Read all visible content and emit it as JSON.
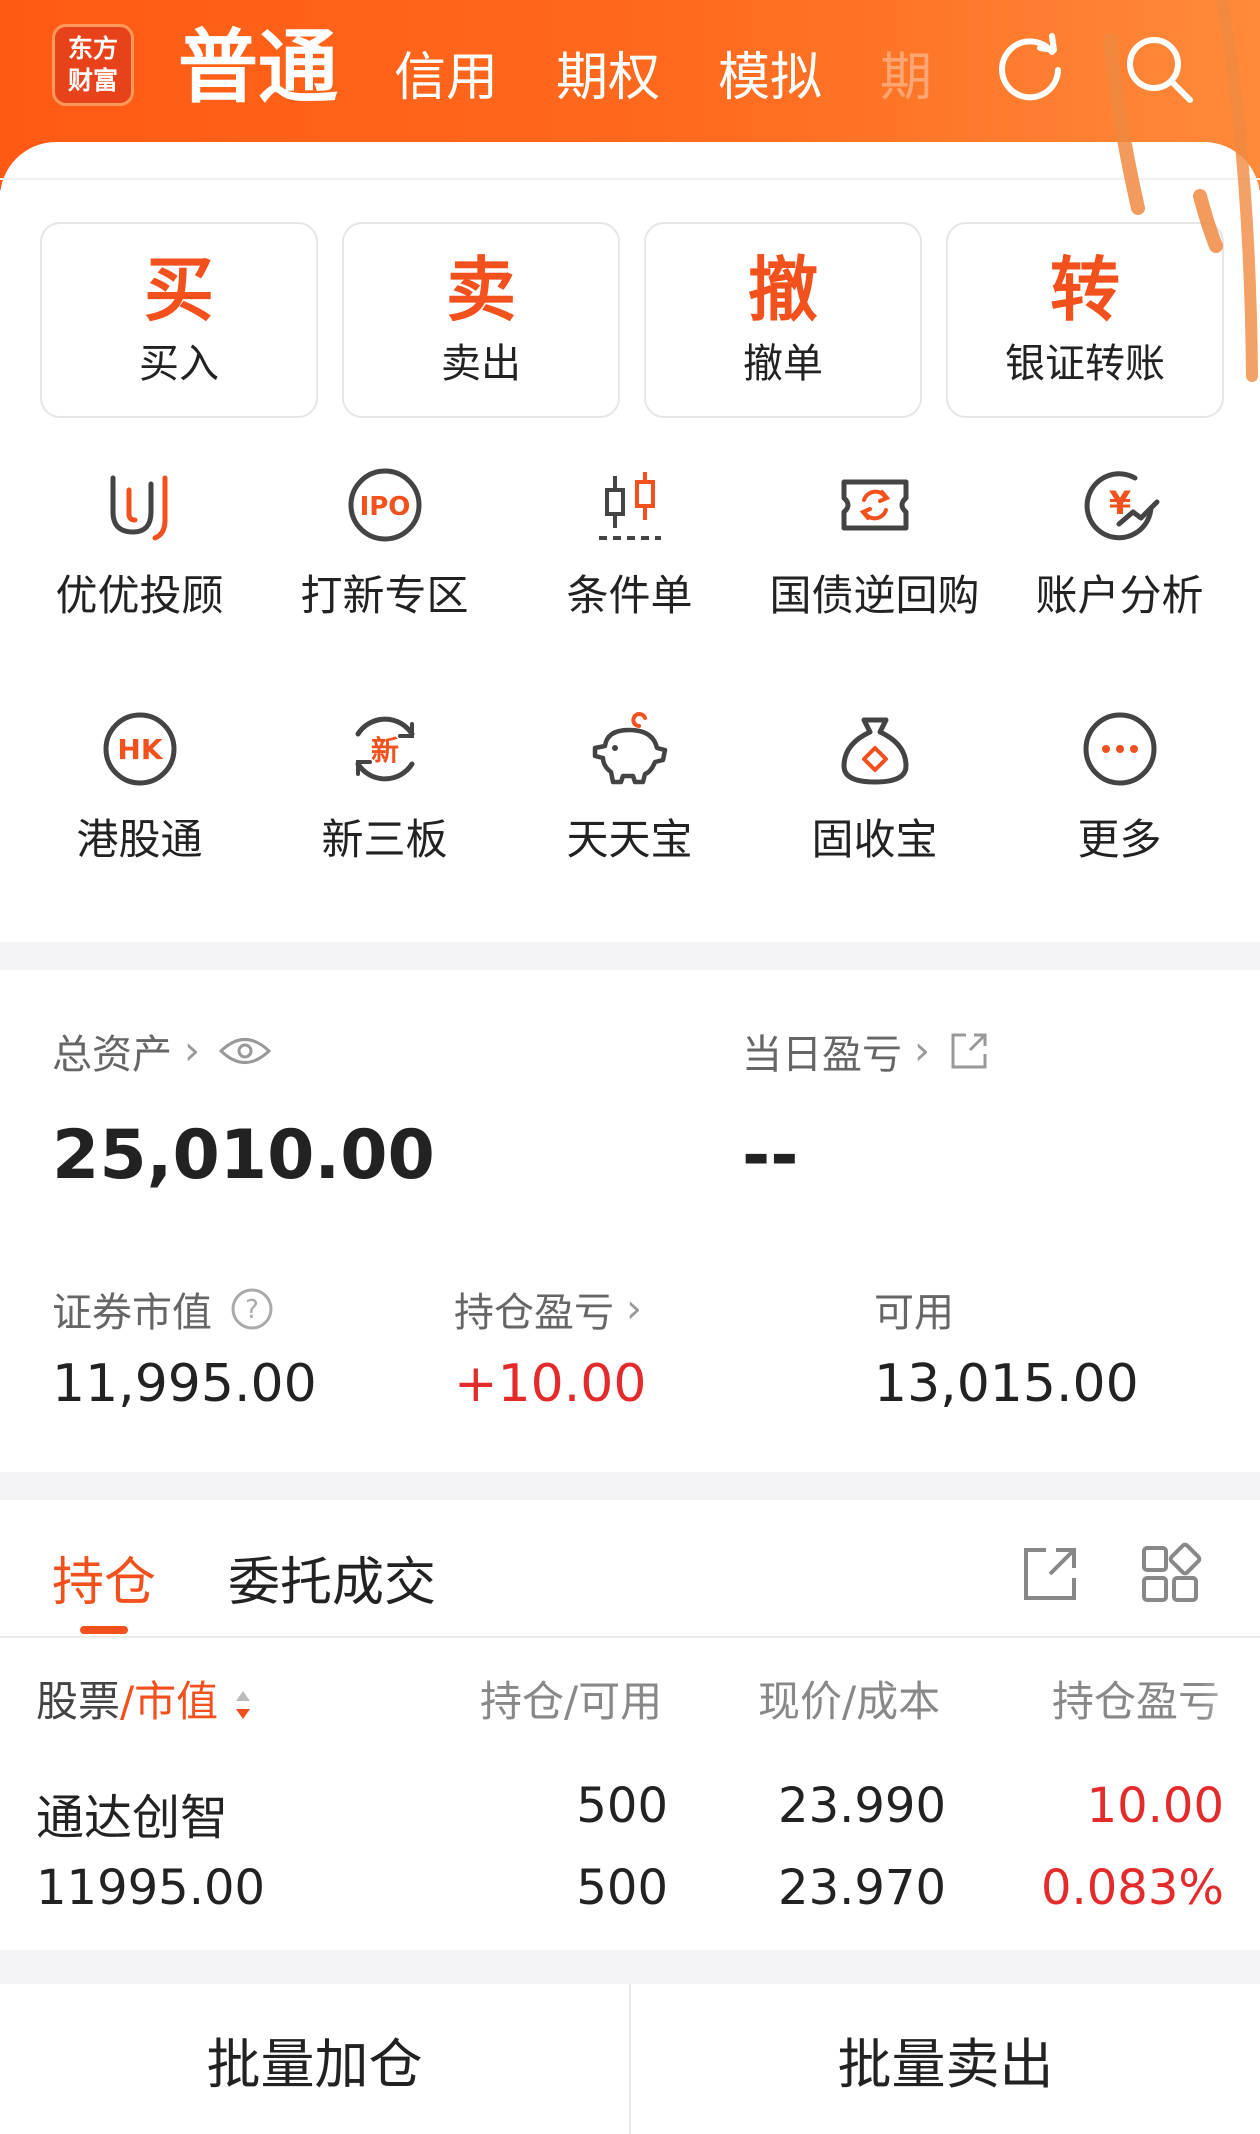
{
  "header": {
    "logo_line1": "东方",
    "logo_line2": "财富",
    "tabs": [
      {
        "label": "普通"
      },
      {
        "label": "信用"
      },
      {
        "label": "期权"
      },
      {
        "label": "模拟"
      },
      {
        "label": "期"
      }
    ]
  },
  "quick_actions": [
    {
      "char": "买",
      "label": "买入"
    },
    {
      "char": "卖",
      "label": "卖出"
    },
    {
      "char": "撤",
      "label": "撤单"
    },
    {
      "char": "转",
      "label": "银证转账"
    }
  ],
  "services_row1": [
    {
      "label": "优优投顾",
      "icon": "uu-advisor-icon"
    },
    {
      "label": "打新专区",
      "icon": "ipo-icon"
    },
    {
      "label": "条件单",
      "icon": "candlestick-icon"
    },
    {
      "label": "国债逆回购",
      "icon": "repo-icon"
    },
    {
      "label": "账户分析",
      "icon": "yen-chart-icon"
    }
  ],
  "services_row2": [
    {
      "label": "港股通",
      "icon": "hk-icon"
    },
    {
      "label": "新三板",
      "icon": "new-board-icon"
    },
    {
      "label": "天天宝",
      "icon": "piggy-bank-icon"
    },
    {
      "label": "固收宝",
      "icon": "money-bag-icon"
    },
    {
      "label": "更多",
      "icon": "more-icon"
    }
  ],
  "assets": {
    "total_label": "总资产",
    "total_value": "25,010.00",
    "daily_pl_label": "当日盈亏",
    "daily_pl_value": "--",
    "market_value_label": "证券市值",
    "market_value": "11,995.00",
    "position_pl_label": "持仓盈亏",
    "position_pl_value": "+10.00",
    "available_label": "可用",
    "available_value": "13,015.00"
  },
  "positions": {
    "tabs": [
      "持仓",
      "委托成交"
    ],
    "columns": {
      "stock": "股票",
      "sep": "/",
      "mv": "市值",
      "qty": "持仓/可用",
      "price": "现价/成本",
      "pl": "持仓盈亏"
    },
    "rows": [
      {
        "name": "通达创智",
        "market_value": "11995.00",
        "hold": "500",
        "available": "500",
        "price": "23.990",
        "cost": "23.970",
        "pl": "10.00",
        "pl_pct": "0.083%"
      }
    ]
  },
  "bottom": {
    "batch_add": "批量加仓",
    "batch_sell": "批量卖出"
  },
  "colors": {
    "brand_orange": "#ff5a14",
    "accent_orange": "#f2501c",
    "profit_red": "#e32b2b"
  }
}
